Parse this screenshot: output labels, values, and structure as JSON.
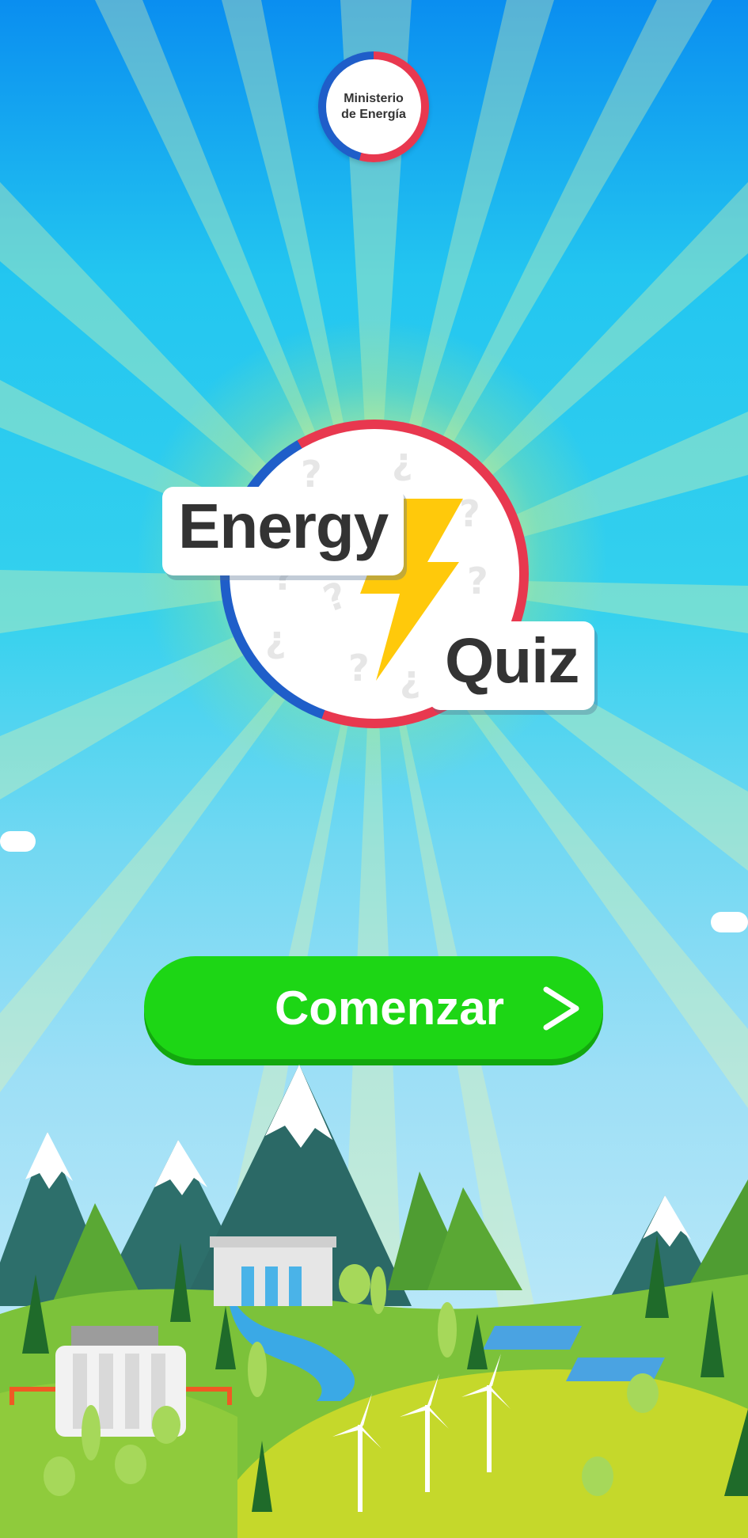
{
  "ministry_badge": {
    "line1": "Ministerio",
    "line2": "de Energía"
  },
  "logo": {
    "word1": "Energy",
    "word2": "Quiz"
  },
  "start_button": {
    "label": "Comenzar"
  },
  "colors": {
    "start_button": "#1dd615",
    "ring_red": "#e8384f",
    "ring_blue": "#1f5ec9",
    "bolt_yellow": "#ffc90b"
  }
}
